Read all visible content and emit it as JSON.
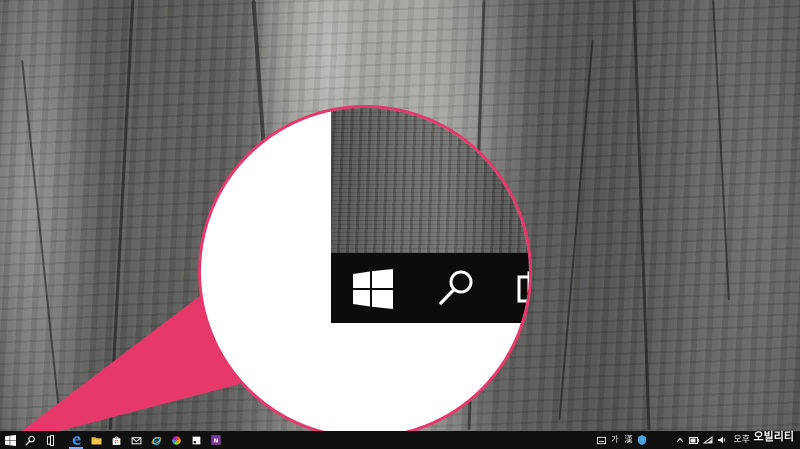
{
  "colors": {
    "callout_accent": "#e6386a",
    "taskbar_bg": "#101010",
    "edge_blue": "#3c8ee6",
    "folder_yellow": "#e8b534",
    "onenote_purple": "#7a3c98"
  },
  "magnifier": {
    "icons": [
      "windows-logo-icon",
      "search-icon",
      "task-view-icon"
    ]
  },
  "taskbar": {
    "pinned": [
      {
        "name": "start-button",
        "icon": "windows-logo-icon"
      },
      {
        "name": "search-button",
        "icon": "search-icon"
      },
      {
        "name": "task-view-button",
        "icon": "task-view-icon"
      },
      {
        "name": "edge-button",
        "icon": "edge-icon"
      },
      {
        "name": "file-explorer-button",
        "icon": "folder-icon"
      },
      {
        "name": "store-button",
        "icon": "store-bag-icon"
      },
      {
        "name": "mail-button",
        "icon": "mail-icon"
      },
      {
        "name": "internet-explorer-button",
        "icon": "ie-icon"
      },
      {
        "name": "photos-button",
        "icon": "color-wheel-icon"
      },
      {
        "name": "paint-button",
        "icon": "paint-icon"
      },
      {
        "name": "onenote-button",
        "icon": "onenote-icon"
      }
    ],
    "tray": {
      "ime_mode": "가",
      "ime_hanja": "漢",
      "clock_label": "오후"
    }
  },
  "watermark": "오빌리티"
}
